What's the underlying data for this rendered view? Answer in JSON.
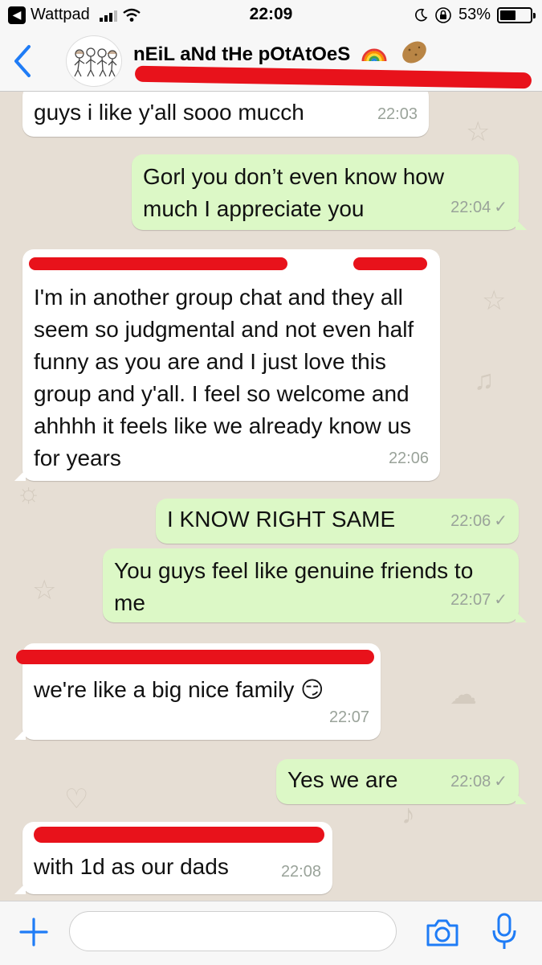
{
  "status_bar": {
    "back_app": "Wattpad",
    "time": "22:09",
    "battery_percent": "53%",
    "battery_level": 0.53
  },
  "header": {
    "title": "nEiL aNd tHe pOtAtOeS",
    "back_icon": "chevron-left-icon",
    "title_emojis": [
      "rainbow",
      "potato"
    ]
  },
  "messages": [
    {
      "direction": "in",
      "text": "guys i like y'all sooo mucch",
      "time": "22:03"
    },
    {
      "direction": "out",
      "text": "Gorl you don’t even know how much I appreciate you",
      "time": "22:04"
    },
    {
      "direction": "in",
      "text": "I'm in another group chat and they all seem so judgmental and not even half funny as you are and I just love this group and y'all. I feel so welcome and ahhhh it feels like we already know us for years",
      "time": "22:06"
    },
    {
      "direction": "out",
      "text": "I KNOW RIGHT SAME",
      "time": "22:06"
    },
    {
      "direction": "out",
      "text": "You guys feel like genuine friends to me",
      "time": "22:07"
    },
    {
      "direction": "in",
      "text": "we're like a big nice family 😏",
      "time": "22:07"
    },
    {
      "direction": "out",
      "text": "Yes we are",
      "time": "22:08"
    },
    {
      "direction": "in",
      "text": "with 1d as our dads",
      "time": "22:08"
    }
  ],
  "input_bar": {
    "placeholder": "",
    "icons": [
      "plus-icon",
      "camera-icon",
      "microphone-icon"
    ]
  },
  "colors": {
    "outgoing_bubble": "#dcf8c6",
    "incoming_bubble": "#ffffff",
    "chat_background": "#e6ded4",
    "accent": "#007aff",
    "redaction": "#e8121b"
  }
}
